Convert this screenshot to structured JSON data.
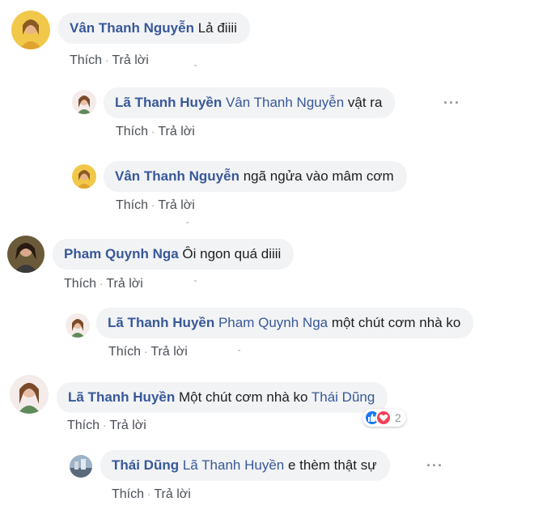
{
  "comments": [
    {
      "author": "Vân Thanh Nguyễn",
      "tag": "",
      "text": "Lả điiii",
      "like": "Thích",
      "reply": "Trả lời"
    },
    {
      "author": "Lã Thanh Huyền",
      "tag": "Vân Thanh Nguyễn",
      "text": "vật ra",
      "like": "Thích",
      "reply": "Trả lời"
    },
    {
      "author": "Vân Thanh Nguyễn",
      "tag": "",
      "text": "ngã ngửa vào mâm cơm",
      "like": "Thích",
      "reply": "Trả lời"
    },
    {
      "author": "Pham Quynh Nga",
      "tag": "",
      "text": "Ôi ngon quá diiii",
      "like": "Thích",
      "reply": "Trả lời"
    },
    {
      "author": "Lã Thanh Huyền",
      "tag": "Pham Quynh Nga",
      "text": "một chút cơm nhà ko",
      "like": "Thích",
      "reply": "Trả lời"
    },
    {
      "author": "Lã Thanh Huyền",
      "tag": "",
      "text": "Một chút cơm nhà ko",
      "tag_after": "Thái Dũng",
      "like": "Thích",
      "reply": "Trả lời",
      "reaction_count": "2"
    },
    {
      "author": "Thái Dũng",
      "tag": "Lã Thanh Huyền",
      "text": "e thèm thật sự",
      "like": "Thích",
      "reply": "Trả lời"
    }
  ],
  "separator": "·",
  "more": "···",
  "colors": {
    "author": "#385898",
    "bubble": "#f2f3f5",
    "like": "#1877f2",
    "love": "#f33e58"
  },
  "icons": {
    "like": "thumbs-up-icon",
    "love": "heart-icon",
    "more": "more-options-icon"
  }
}
